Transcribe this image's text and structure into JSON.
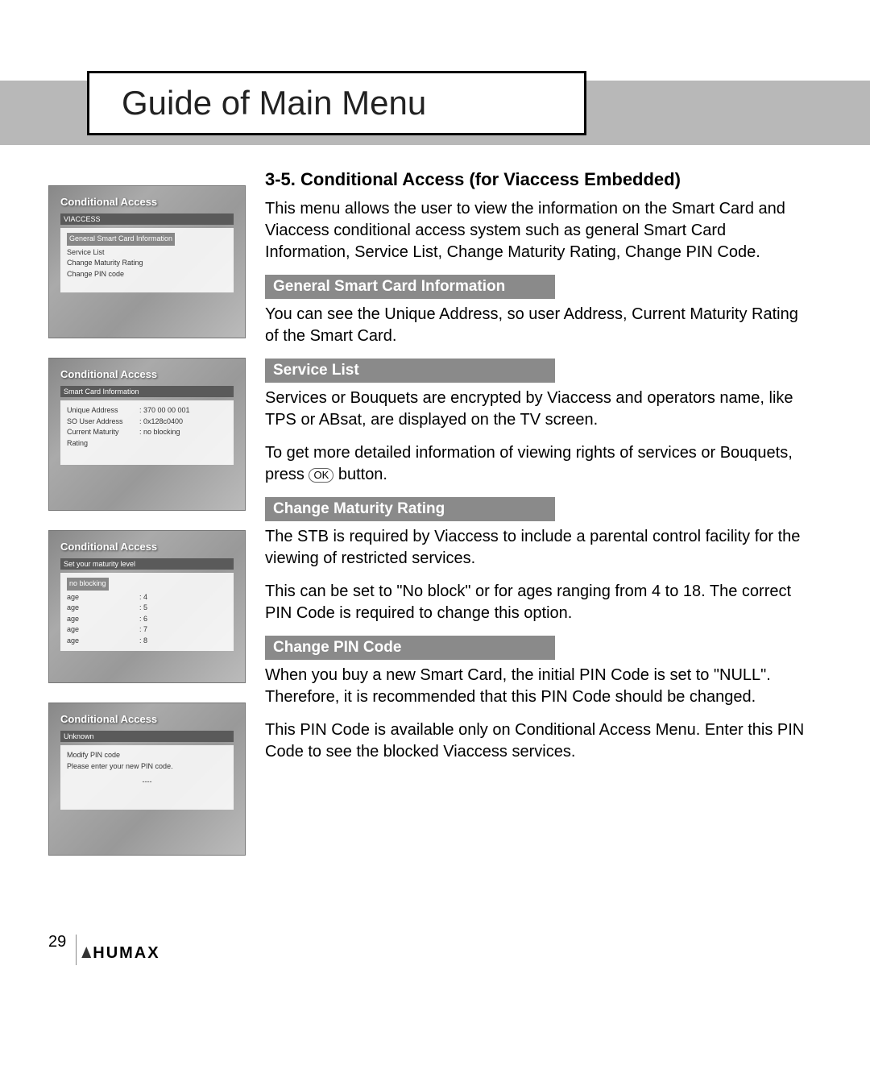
{
  "title": "Guide of Main Menu",
  "heading": "3-5. Conditional Access (for Viaccess Embedded)",
  "intro": "This menu allows the user to view the information on the Smart Card and Viaccess conditional access system such as general Smart Card Information, Service List, Change Maturity Rating, Change PIN Code.",
  "sections": {
    "general": {
      "title": "General Smart Card Information",
      "body": "You can see the Unique Address, so user Address, Current Maturity Rating of the Smart Card."
    },
    "service": {
      "title": "Service List",
      "body1": "Services or Bouquets are encrypted by Viaccess and operators name, like TPS or ABsat, are displayed on the TV screen.",
      "body2a": "To get more detailed information of viewing rights of services or Bouquets, press ",
      "body2b": " button.",
      "ok": "OK"
    },
    "maturity": {
      "title": "Change Maturity Rating",
      "body1": "The STB is required by Viaccess to include a parental control facility for the viewing of restricted services.",
      "body2": "This can be set to \"No block\" or for ages ranging from 4 to 18. The correct PIN Code is required to change this option."
    },
    "pin": {
      "title": "Change PIN Code",
      "body1": "When you buy a new Smart Card, the initial PIN Code is set to \"NULL\". Therefore, it is recommended that this PIN Code should be changed.",
      "body2": "This PIN Code is available only on Conditional Access Menu. Enter this PIN Code to see the blocked Viaccess services."
    }
  },
  "screenshots": {
    "s1": {
      "title": "Conditional Access",
      "sub": "VIACCESS",
      "items": [
        "General Smart Card Information",
        "Service List",
        "Change Maturity Rating",
        "Change PIN code"
      ]
    },
    "s2": {
      "title": "Conditional Access",
      "sub": "Smart Card Information",
      "rows": [
        {
          "k": "Unique Address",
          "v": ": 370 00 00 001"
        },
        {
          "k": "SO User Address",
          "v": ": 0x128c0400"
        },
        {
          "k": "Current Maturity Rating",
          "v": ": no blocking"
        }
      ]
    },
    "s3": {
      "title": "Conditional Access",
      "sub": "Set your maturity level",
      "hl": "no blocking",
      "rows": [
        {
          "k": "age",
          "v": ": 4"
        },
        {
          "k": "age",
          "v": ": 5"
        },
        {
          "k": "age",
          "v": ": 6"
        },
        {
          "k": "age",
          "v": ": 7"
        },
        {
          "k": "age",
          "v": ": 8"
        }
      ]
    },
    "s4": {
      "title": "Conditional Access",
      "sub": "Unknown",
      "body1": "Modify PIN code",
      "body2": "Please enter your new PIN code.",
      "body3": "----"
    }
  },
  "page_number": "29",
  "brand": "HUMAX"
}
